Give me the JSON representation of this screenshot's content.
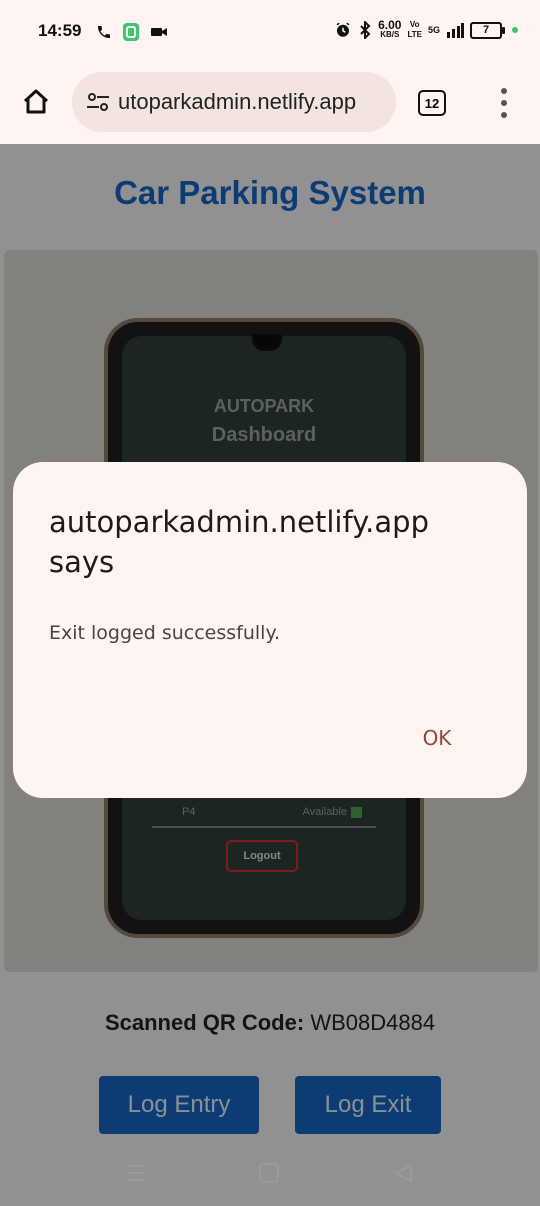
{
  "status_bar": {
    "time": "14:59",
    "net_speed_value": "6.00",
    "net_speed_unit": "KB/S",
    "volte_top": "Vo",
    "volte_bottom": "LTE",
    "signal_label": "5G",
    "battery_level": "7",
    "icons": [
      "phone-call-icon",
      "whatsapp-icon",
      "video-icon",
      "alarm-icon",
      "bluetooth-icon",
      "signal-icon",
      "battery-icon"
    ]
  },
  "browser": {
    "url": "utoparkadmin.netlify.app",
    "tab_count": "12",
    "icons": [
      "home-icon",
      "site-settings-icon",
      "tabs-icon",
      "more-menu-icon"
    ]
  },
  "page": {
    "title": "Car Parking System",
    "camera_preview": {
      "brand_line1": "AUTOPARK",
      "brand_line2": "Dashboard",
      "slot": "P4",
      "slot_status": "Available",
      "logout_label": "Logout"
    },
    "scanned_label": "Scanned QR Code:",
    "scanned_value": "WB08D4884",
    "log_entry_label": "Log Entry",
    "log_exit_label": "Log Exit",
    "accent_color": "#1565c0"
  },
  "dialog": {
    "title": "autoparkadmin.netlify.app says",
    "message": "Exit logged successfully.",
    "ok_label": "OK"
  },
  "navbar": {
    "icons": [
      "recents-icon",
      "home-square-icon",
      "back-icon"
    ]
  }
}
